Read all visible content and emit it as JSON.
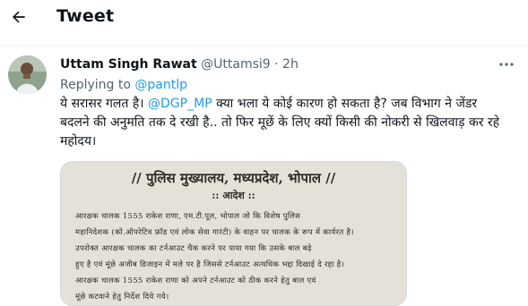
{
  "header": {
    "title": "Tweet",
    "back_icon": "arrow-left-icon"
  },
  "tweet": {
    "author_name": "Uttam Singh Rawat",
    "author_handle": "@Uttamsi9",
    "separator": "·",
    "time": "2h",
    "replying_prefix": "Replying to",
    "replying_to": "@pantlp",
    "text_part1": "ये सरासर गलत है। ",
    "mention": "@DGP_MP",
    "text_part2": " क्या भला ये कोई कारण हो सकता है? जब विभाग ने जेंडर बदलने की अनुमति तक दे रखी है.. तो फिर मूछें के लिए क्यों किसी की नोकरी से खिलवाड़ कर रहे महोदय।",
    "more_icon": "more-horizontal-icon",
    "accent_color": "#1d9bf0"
  },
  "document": {
    "title": "// पुलिस मुख्यालय, मध्यप्रदेश, भोपाल //",
    "subtitle": ":: आदेश ::",
    "lines": [
      "आरक्षक चालक 1555 राकेश राणा, एम.टी.पूल, भोपाल जो कि विशेष पुलिस",
      "महानिदेशक (को.ऑपरेटिव फ्रॉड एवं लोक सेवा गारंटी) के वाहन पर चालक के रूप में कार्यरत है।",
      "उपरोक्त आरक्षक चालक का टर्नआउट चैक करने पर पाया गया कि उसके बाल बढ़े",
      "हुए है एवं मूंछे अजीब डिजाइन में मले पर है जिससे टर्नआउट अत्यधिक भद्दा दिखाई दे रहा है।",
      "आरक्षक चालक 1555 राकेश राणा को अपने टर्नआउट को ठीक करने हेतु बाल एवं",
      "मूंछे कटवाने हेतु निर्देश दिये गये।"
    ]
  }
}
